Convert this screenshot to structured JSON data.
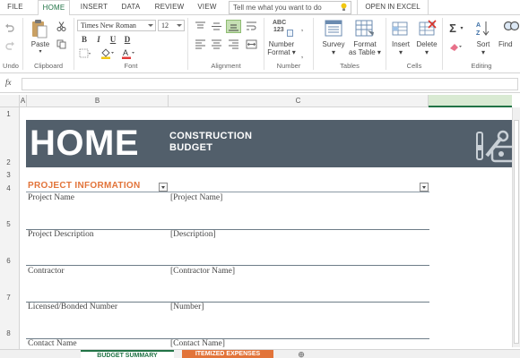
{
  "tabs": [
    "FILE",
    "HOME",
    "INSERT",
    "DATA",
    "REVIEW",
    "VIEW"
  ],
  "active_tab": "HOME",
  "tell_me_placeholder": "Tell me what you want to do",
  "open_in_excel": "OPEN IN EXCEL",
  "ribbon": {
    "undo_label": "Undo",
    "clipboard": {
      "paste": "Paste",
      "group": "Clipboard"
    },
    "font": {
      "name": "Times New Roman",
      "size": "12",
      "bold": "B",
      "italic": "I",
      "underline": "U",
      "strike": "D",
      "group": "Font"
    },
    "alignment": {
      "group": "Alignment"
    },
    "number": {
      "abc": "ABC",
      "digits": "123",
      "label1": "Number",
      "label2": "Format",
      "group": "Number"
    },
    "tables": {
      "survey": "Survey",
      "format1": "Format",
      "format2": "as Table",
      "group": "Tables"
    },
    "cells": {
      "insert": "Insert",
      "delete": "Delete",
      "group": "Cells"
    },
    "editing": {
      "sort": "Sort",
      "find": "Find",
      "group": "Editing"
    }
  },
  "formula_bar": {
    "fx": "fx",
    "value": ""
  },
  "columns": [
    "A",
    "B",
    "C"
  ],
  "rows": [
    "1",
    "2",
    "3",
    "4",
    "5",
    "6",
    "7",
    "8"
  ],
  "hero": {
    "title": "HOME",
    "subtitle_line1": "CONSTRUCTION",
    "subtitle_line2": "BUDGET"
  },
  "section": {
    "title": "PROJECT INFORMATION"
  },
  "fields": [
    {
      "label": "Project Name",
      "value": "[Project Name]"
    },
    {
      "label": "Project Description",
      "value": "[Description]"
    },
    {
      "label": "Contractor",
      "value": "[Contractor Name]"
    },
    {
      "label": "Licensed/Bonded Number",
      "value": "[Number]"
    },
    {
      "label": "Contact Name",
      "value": "[Contact Name]"
    }
  ],
  "sheets": [
    {
      "name": "BUDGET SUMMARY",
      "color": "#217346"
    },
    {
      "name": "ITEMIZED EXPENSES",
      "color": "#e2743a"
    }
  ],
  "colors": {
    "accent": "#217346",
    "banner": "#525f6b",
    "section": "#e2743a"
  }
}
